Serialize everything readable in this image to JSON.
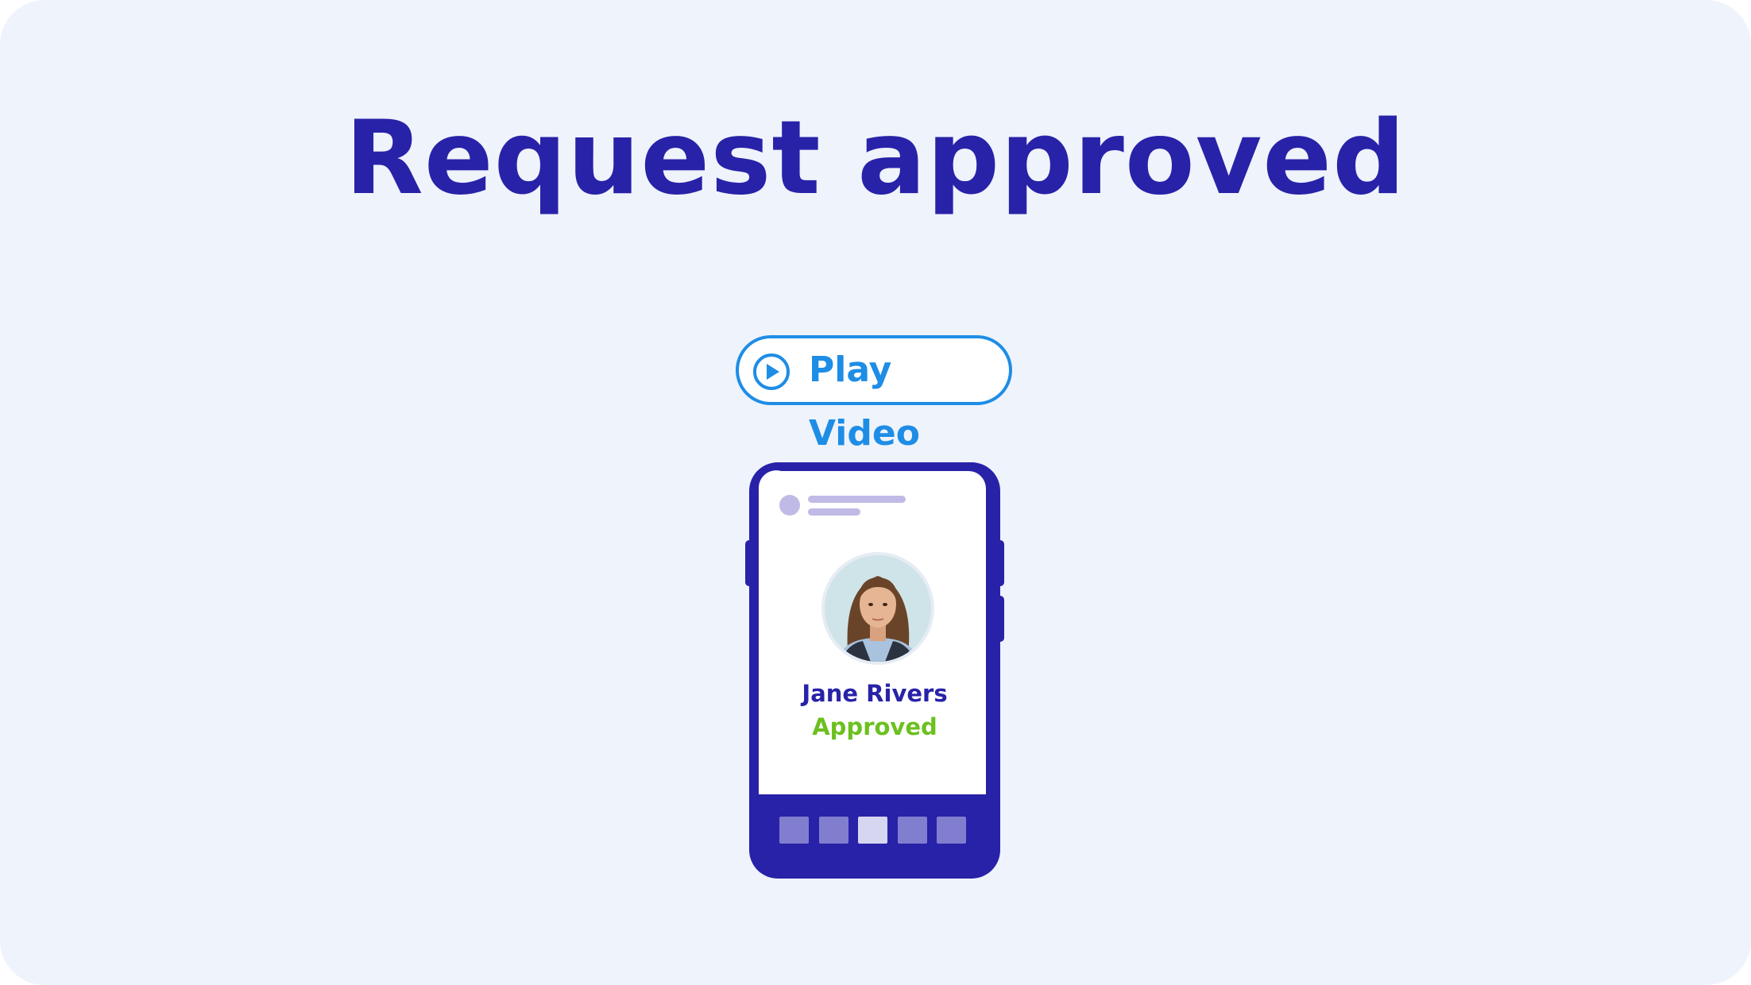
{
  "header": {
    "title": "Request approved"
  },
  "actions": {
    "play_label": "Play Video"
  },
  "profile": {
    "name": "Jane Rivers",
    "status": "Approved"
  },
  "colors": {
    "accent": "#2822a8",
    "link": "#1e8de6",
    "success": "#6cc01f",
    "background": "#eff3fb"
  },
  "icons": {
    "play": "play-circle-icon"
  }
}
